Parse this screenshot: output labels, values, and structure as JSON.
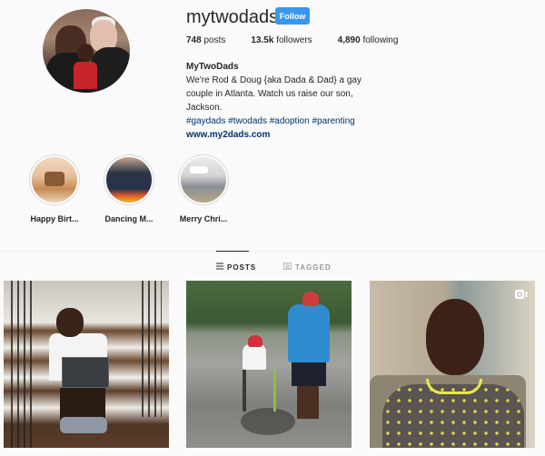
{
  "profile": {
    "username": "mytwodads",
    "follow_label": "Follow",
    "stats": {
      "posts_count": "748",
      "posts_label": "posts",
      "followers_count": "13.5k",
      "followers_label": "followers",
      "following_count": "4,890",
      "following_label": "following"
    },
    "bio": {
      "name": "MyTwoDads",
      "text": "We're Rod & Doug {aka Dada & Dad} a gay couple in Atlanta. Watch us raise our son, Jackson.",
      "hashtags": "#gaydads #twodads #adoption #parenting",
      "link": "www.my2dads.com"
    }
  },
  "highlights": [
    {
      "label": "Happy Birt..."
    },
    {
      "label": "Dancing M..."
    },
    {
      "label": "Merry Chri..."
    }
  ],
  "tabs": [
    {
      "label": "POSTS",
      "icon": "grid-icon",
      "active": true
    },
    {
      "label": "TAGGED",
      "icon": "tagged-icon",
      "active": false
    }
  ],
  "posts": [
    {
      "description": "Boy sitting on stairs holding first day of school sign",
      "type": "photo"
    },
    {
      "description": "Dad walking beside child riding bike in park",
      "type": "photo"
    },
    {
      "description": "Boy in star pajamas sitting in chair",
      "type": "video"
    }
  ],
  "colors": {
    "accent": "#3897f0",
    "link": "#003569",
    "text": "#262626",
    "background": "#fafafa"
  }
}
